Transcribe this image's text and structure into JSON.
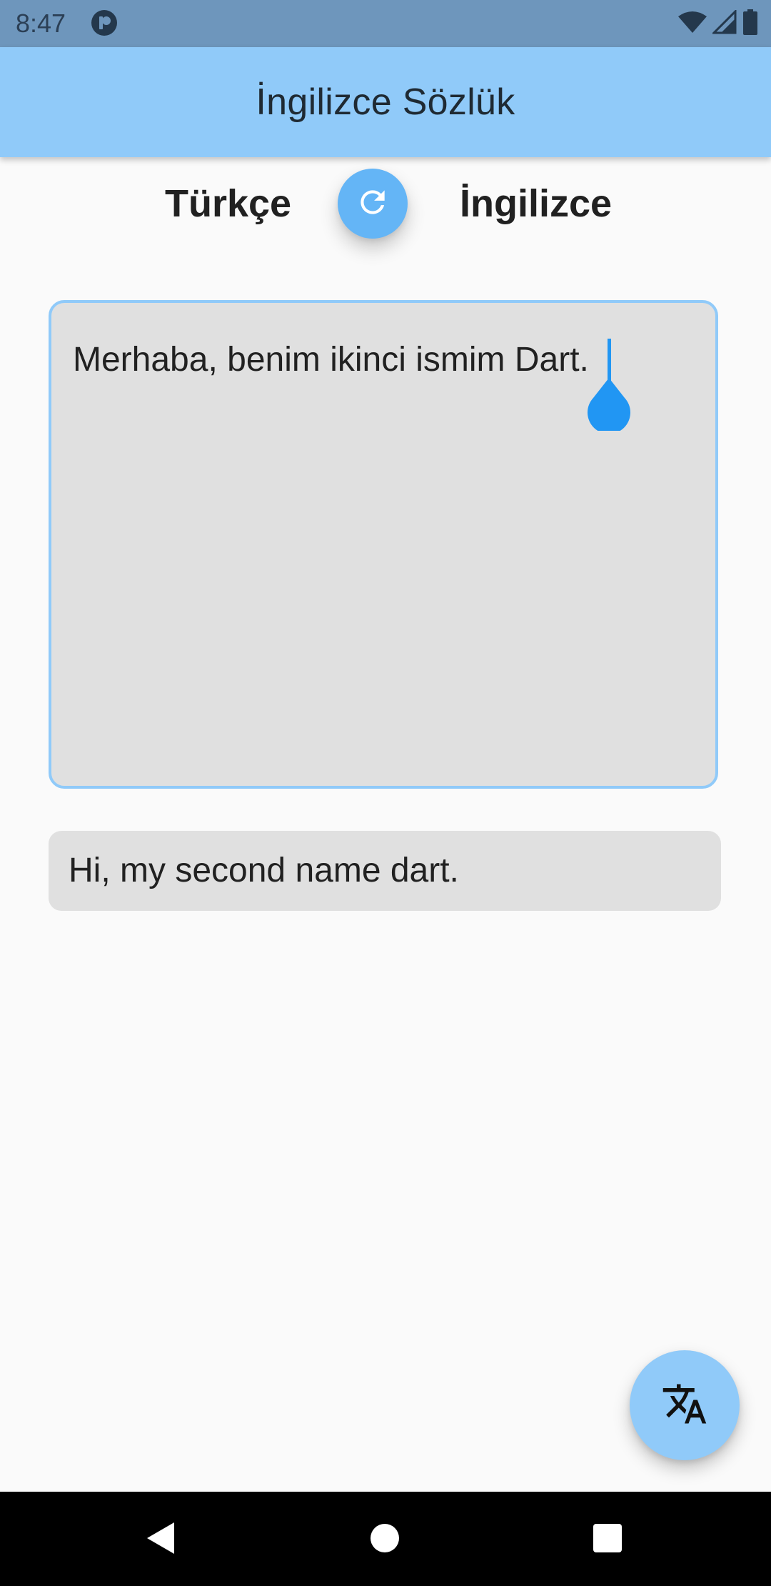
{
  "status_bar": {
    "time": "8:47",
    "icons": [
      "app-notification-icon",
      "wifi-icon",
      "cellular-signal-icon",
      "battery-icon"
    ]
  },
  "app_bar": {
    "title": "İngilizce Sözlük",
    "color": "#90CAF9"
  },
  "language_selector": {
    "source_language": "Türkçe",
    "target_language": "İngilizce",
    "swap_icon": "refresh-icon",
    "swap_color": "#64B5F6"
  },
  "input": {
    "value": "Merhaba, benim ikinci ismim Dart.",
    "border_color": "#90CAF9",
    "background": "#E0E0E0",
    "cursor_color": "#2196F3"
  },
  "output": {
    "value": "Hi, my second name dart.",
    "background": "#E0E0E0"
  },
  "fab": {
    "icon": "translate-icon",
    "color": "#90CAF9"
  },
  "nav_bar": {
    "buttons": [
      "back-icon",
      "home-icon",
      "recents-icon"
    ]
  }
}
